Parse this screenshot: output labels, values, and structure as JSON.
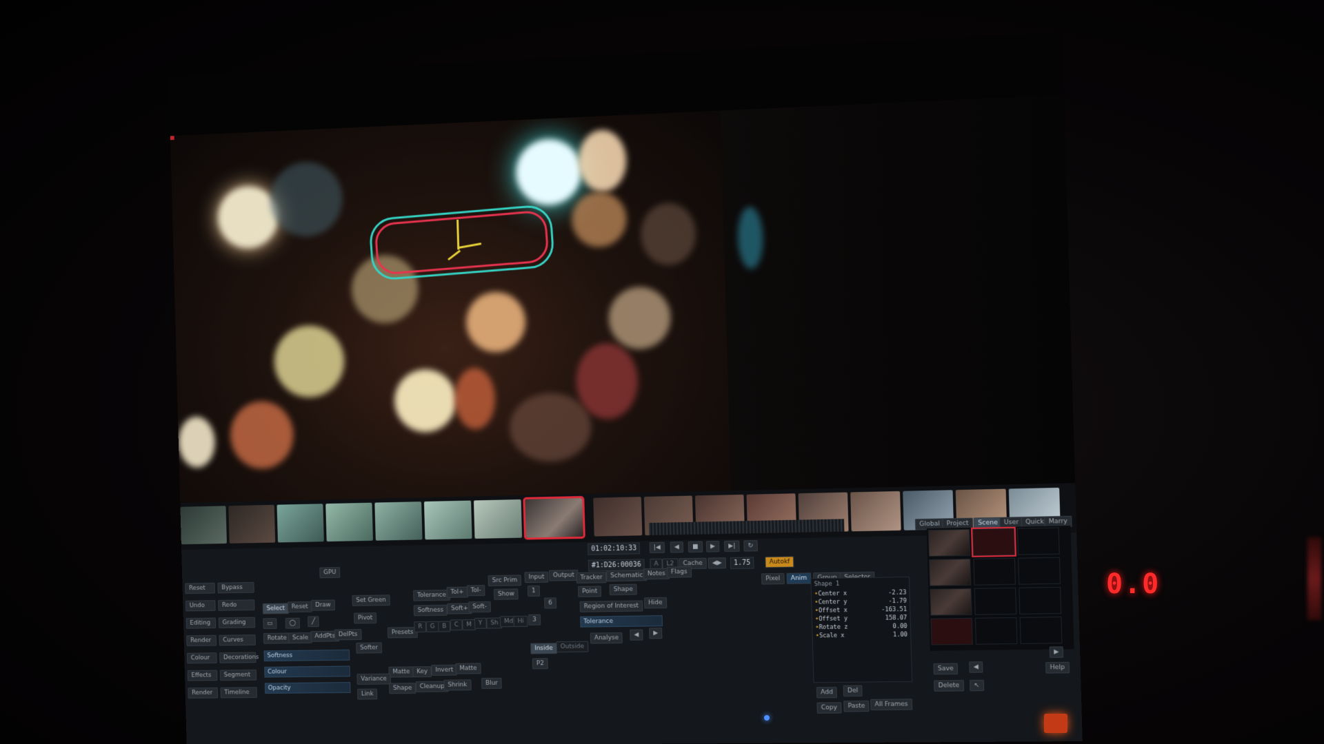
{
  "panel": {
    "timecode": "01:02:10:33",
    "frame_code": "#1:D26:00036",
    "speed_value": "1.75",
    "top_tabs": [
      "Global",
      "Project",
      "Scene",
      "User",
      "Quick",
      "Marry"
    ],
    "transport_buttons": [
      "A",
      "L2",
      "Cache"
    ],
    "right_buttons": [
      "Pixel",
      "Anim",
      "Group",
      "Selector",
      "Autokf"
    ],
    "left_menu": [
      [
        "Reset",
        "Bypass"
      ],
      [
        "Undo",
        "Redo"
      ],
      [
        "Editing",
        "Grading"
      ],
      [
        "Render",
        "Curves"
      ],
      [
        "Colour",
        "Decorations"
      ],
      [
        "Effects",
        "Segment"
      ],
      [
        "Render",
        "Timeline"
      ]
    ],
    "tool_buttons": [
      "GPU",
      "Select",
      "Reset",
      "Draw",
      "Rotate",
      "Scale",
      "AddPts",
      "DelPts",
      "Pivot",
      "Softer"
    ],
    "shape_fields": [
      "Softness",
      "Colour",
      "Opacity"
    ],
    "matte_buttons": [
      "Presets",
      "Show",
      "Tolerance",
      "Softness",
      "Tol+",
      "Tol-",
      "Soft+",
      "Soft-",
      "Src Prim",
      "Set Green"
    ],
    "channel_buttons": [
      "R",
      "G",
      "B",
      "C",
      "M",
      "Y",
      "Sh",
      "Md",
      "Hi"
    ],
    "bottom_buttons": [
      "Matte",
      "Key",
      "Invert",
      "Matte",
      "Variance",
      "Shape",
      "Cleanup",
      "Shrink",
      "Blur",
      "Link"
    ],
    "io": {
      "input": "Input",
      "output": "Output",
      "inside": "Inside",
      "outside": "Outside"
    },
    "tracker": {
      "tabs": [
        "Tracker",
        "Schematic",
        "Notes",
        "Flags"
      ],
      "buttons": [
        "Point",
        "Shape",
        "Region of Interest",
        "Hide",
        "Tolerance",
        "Analyse"
      ]
    },
    "params": {
      "header": "Shape 1",
      "rows": [
        {
          "label": "Center x",
          "value": "-2.23"
        },
        {
          "label": "Center y",
          "value": "-1.79"
        },
        {
          "label": "Offset x",
          "value": "-163.51"
        },
        {
          "label": "Offset y",
          "value": "158.07"
        },
        {
          "label": "Rotate z",
          "value": "0.00"
        },
        {
          "label": "Scale x",
          "value": "1.00"
        }
      ],
      "actions": [
        "Add",
        "Del",
        "Copy",
        "Paste",
        "All Frames"
      ]
    },
    "bin_actions": [
      "Save",
      "Delete",
      "Help"
    ]
  },
  "hardware": {
    "led_display": "0.0"
  },
  "colors": {
    "roto_outer": "#35d3c4",
    "roto_inner": "#e8334f",
    "selection": "#e02a3a",
    "autokf": "#c98a1c",
    "led": "#ff2a2a"
  }
}
